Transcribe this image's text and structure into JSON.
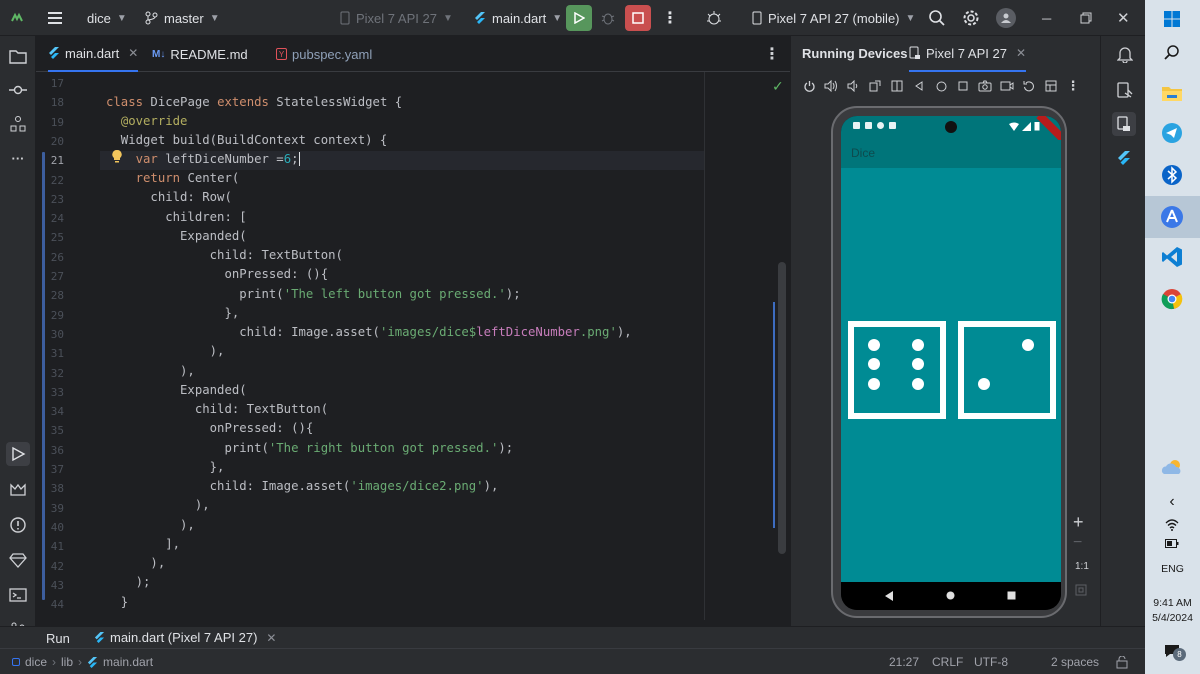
{
  "titlebar": {
    "project": "dice",
    "branch": "master",
    "device_config": "Pixel 7 API 27",
    "run_config": "main.dart",
    "device_selector": "Pixel 7 API 27 (mobile)"
  },
  "editor_tabs": [
    {
      "label": "main.dart",
      "active": true
    },
    {
      "label": "README.md",
      "active": false
    },
    {
      "label": "pubspec.yaml",
      "active": false
    }
  ],
  "code": {
    "line_numbers": [
      "17",
      "18",
      "19",
      "20",
      "21",
      "22",
      "23",
      "24",
      "25",
      "26",
      "27",
      "28",
      "29",
      "30",
      "31",
      "32",
      "33",
      "34",
      "35",
      "36",
      "37",
      "38",
      "39",
      "40",
      "41",
      "42",
      "43",
      "44"
    ],
    "current_line": "21"
  },
  "devices": {
    "panel_title": "Running Devices",
    "device_tab": "Pixel 7 API 27",
    "app_title": "Dice",
    "zoom_label": "1:1",
    "dice": [
      {
        "value": 6
      },
      {
        "value": 2
      }
    ]
  },
  "run": {
    "tab_label": "Run",
    "config_tab": "main.dart (Pixel 7 API 27)"
  },
  "status": {
    "breadcrumb": [
      "dice",
      "lib",
      "main.dart"
    ],
    "position": "21:27",
    "line_ending": "CRLF",
    "encoding": "UTF-8",
    "indent": "2 spaces"
  },
  "taskbar": {
    "language": "ENG",
    "time": "9:41 AM",
    "date": "5/4/2024",
    "notification_count": "8"
  },
  "colors": {
    "accent": "#3574f0",
    "run_green": "#57965c",
    "stop_red": "#c94f4f",
    "app_teal": "#008b94"
  }
}
